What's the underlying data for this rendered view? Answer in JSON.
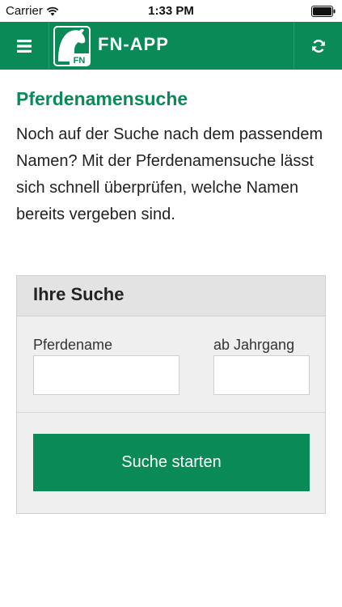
{
  "status_bar": {
    "carrier": "Carrier",
    "time": "1:33 PM"
  },
  "app_bar": {
    "title": "FN-APP",
    "logo_text": "FN",
    "menu_icon": "hamburger-menu-icon",
    "refresh_icon": "refresh-icon",
    "color": "#0a8a56"
  },
  "page": {
    "title": "Pferdenamensuche",
    "intro": "Noch auf der Suche nach dem passendem Namen? Mit der Pferdenamensuche lässt sich schnell überprüfen, welche Namen bereits vergeben sind."
  },
  "search": {
    "title": "Ihre Suche",
    "name_label": "Pferdename",
    "name_value": "",
    "year_label": "ab Jahrgang",
    "year_value": "",
    "submit_label": "Suche starten"
  }
}
